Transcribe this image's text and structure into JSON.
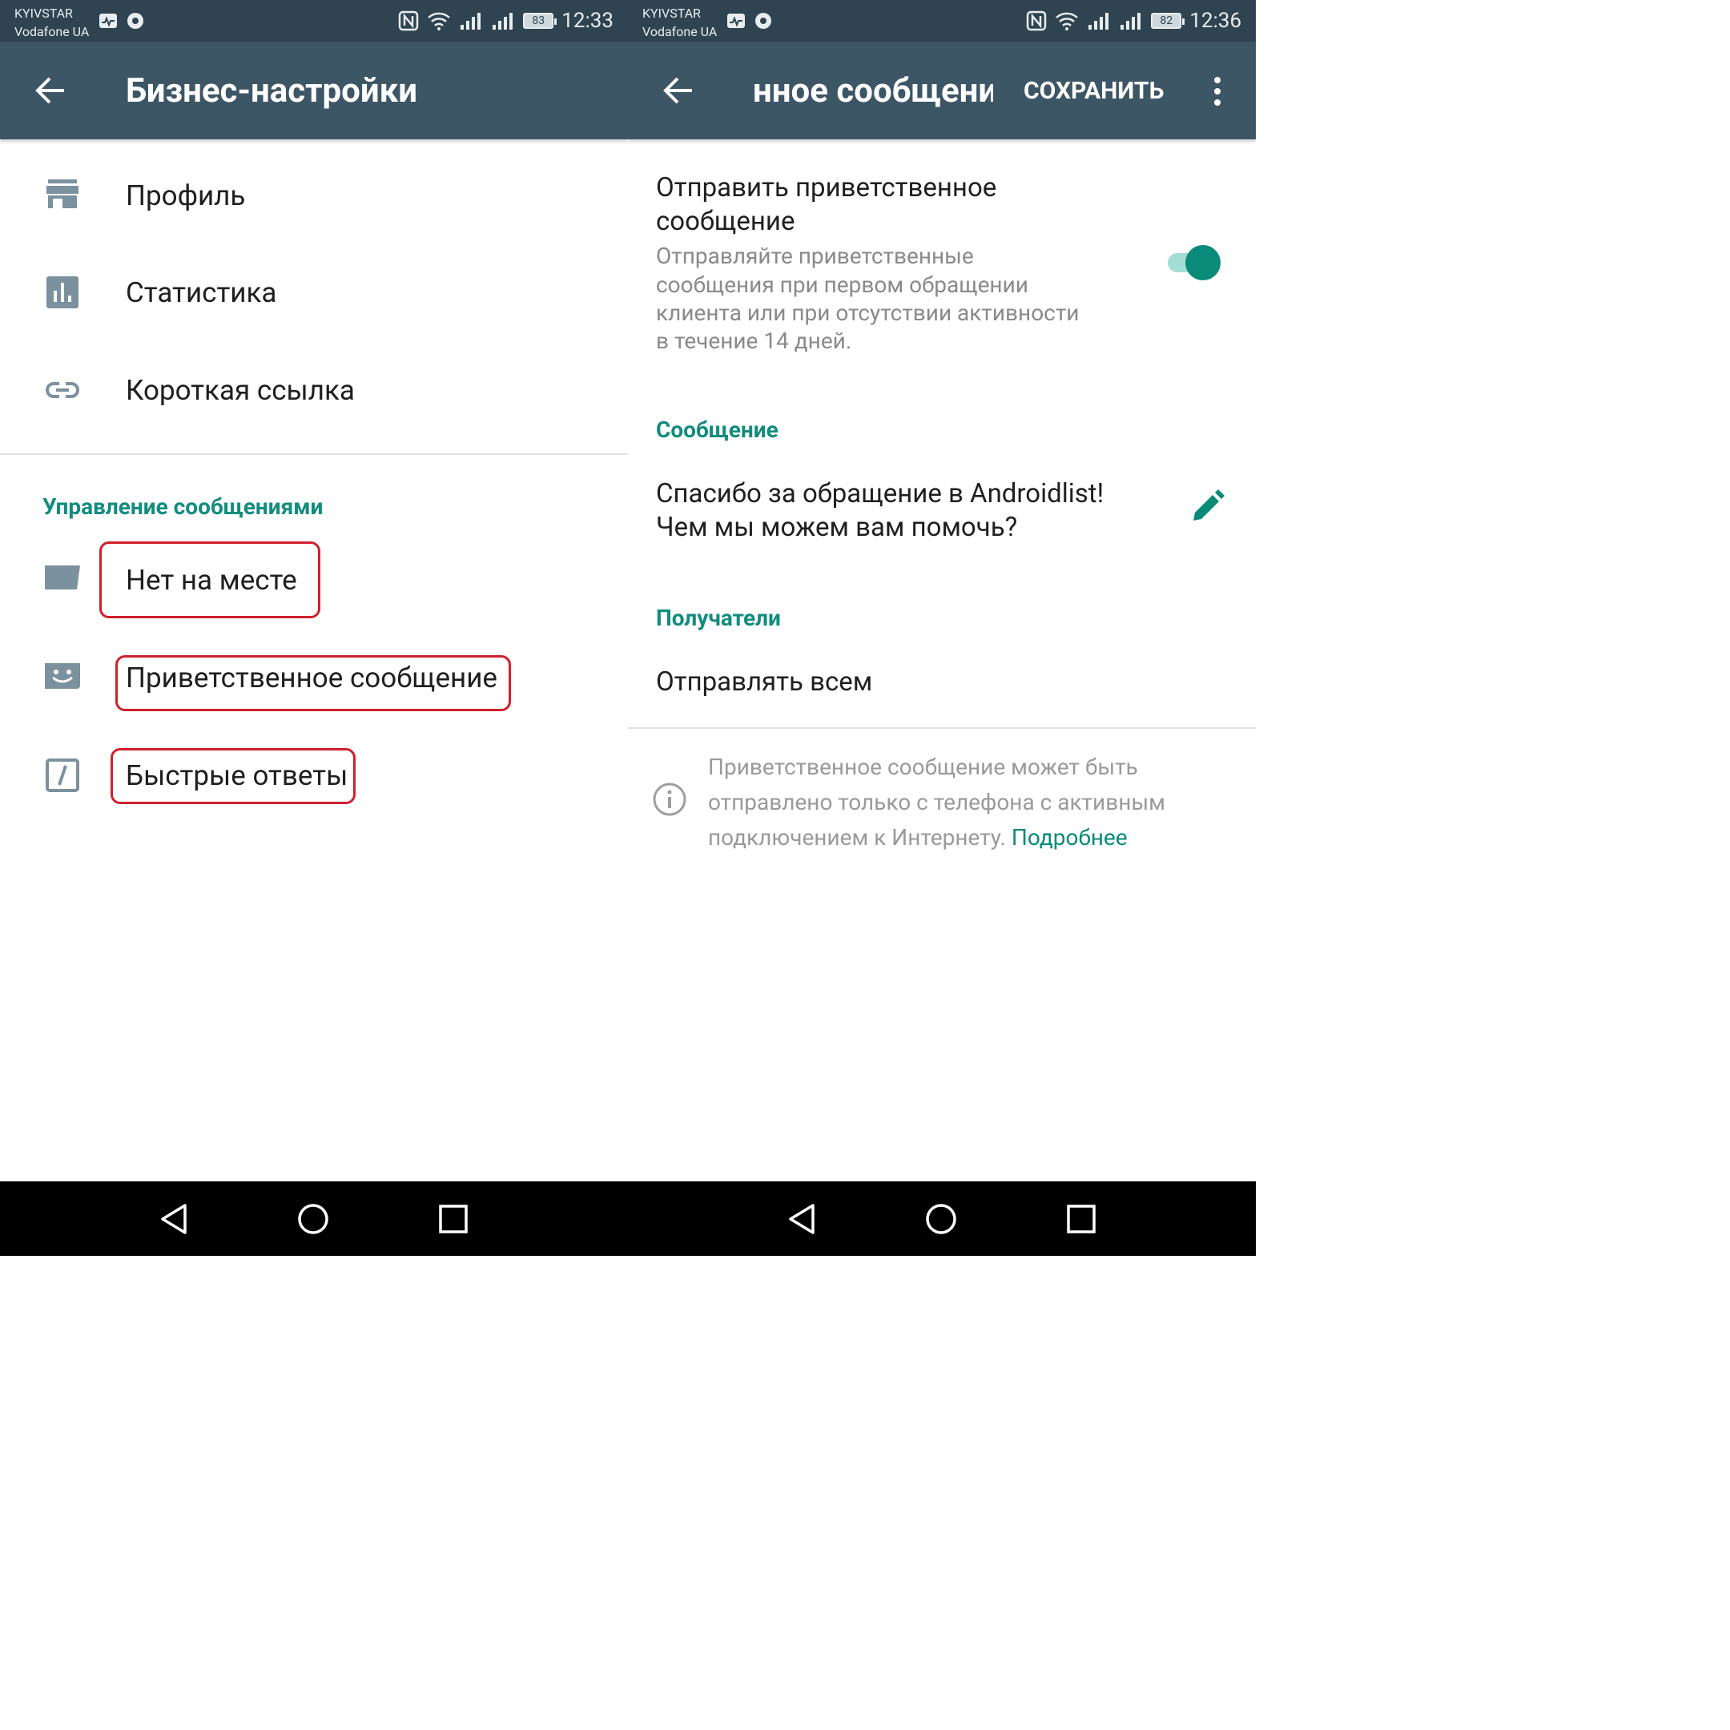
{
  "left": {
    "status": {
      "carrier1": "KYIVSTAR",
      "carrier2": "Vodafone UA",
      "battery": "83",
      "time": "12:33"
    },
    "appbar": {
      "title": "Бизнес-настройки"
    },
    "items": [
      {
        "label": "Профиль"
      },
      {
        "label": "Статистика"
      },
      {
        "label": "Короткая ссылка"
      }
    ],
    "section_title": "Управление сообщениями",
    "message_items": [
      {
        "label": "Нет на месте"
      },
      {
        "label": "Приветственное сообщение"
      },
      {
        "label": "Быстрые ответы"
      }
    ]
  },
  "right": {
    "status": {
      "carrier1": "KYIVSTAR",
      "carrier2": "Vodafone UA",
      "battery": "82",
      "time": "12:36"
    },
    "appbar": {
      "title": "нное сообщени",
      "save": "СОХРАНИТЬ"
    },
    "toggle": {
      "title_line1": "Отправить приветственное",
      "title_line2": "сообщение",
      "desc_line1": "Отправляйте приветственные",
      "desc_line2": "сообщения при первом обращении",
      "desc_line3": "клиента или при отсутствии активности",
      "desc_line4": "в течение 14 дней.",
      "enabled": true
    },
    "message_section": "Сообщение",
    "message_line1": "Спасибо за обращение в Androidlist!",
    "message_line2": "Чем мы можем вам помочь?",
    "recipients_section": "Получатели",
    "recipients_value": "Отправлять всем",
    "info_line1": "Приветственное сообщение может быть",
    "info_line2": "отправлено только с телефона с активным",
    "info_line3": "подключением к Интернету.",
    "info_link": "Подробнее"
  },
  "colors": {
    "appbar": "#3d5666",
    "statusbar": "#2f4350",
    "accent": "#128c7e",
    "highlight": "#d0202e",
    "icon": "#7c919e"
  }
}
